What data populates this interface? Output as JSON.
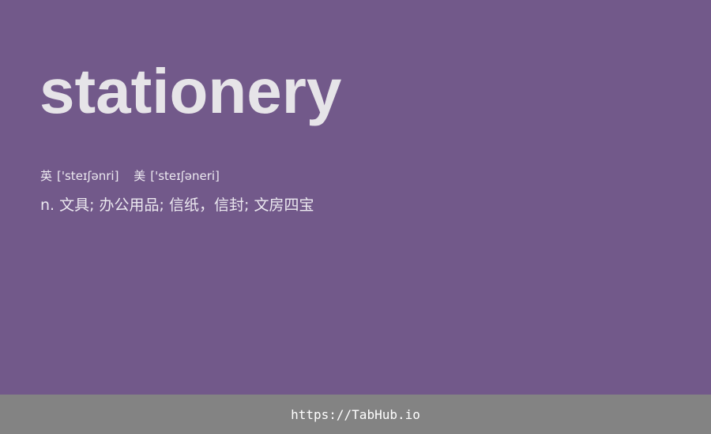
{
  "word": "stationery",
  "pronunciations": {
    "uk": {
      "region": "英",
      "ipa": "['steɪʃənri]"
    },
    "us": {
      "region": "美",
      "ipa": "['steɪʃəneri]"
    }
  },
  "definition": "n. 文具; 办公用品; 信纸，信封; 文房四宝",
  "footer": {
    "link_text": "https://TabHub.io"
  },
  "colors": {
    "background": "#72598a",
    "footer_background": "#838383",
    "word_text": "#e6e4e8",
    "body_text": "#ece9f0"
  }
}
